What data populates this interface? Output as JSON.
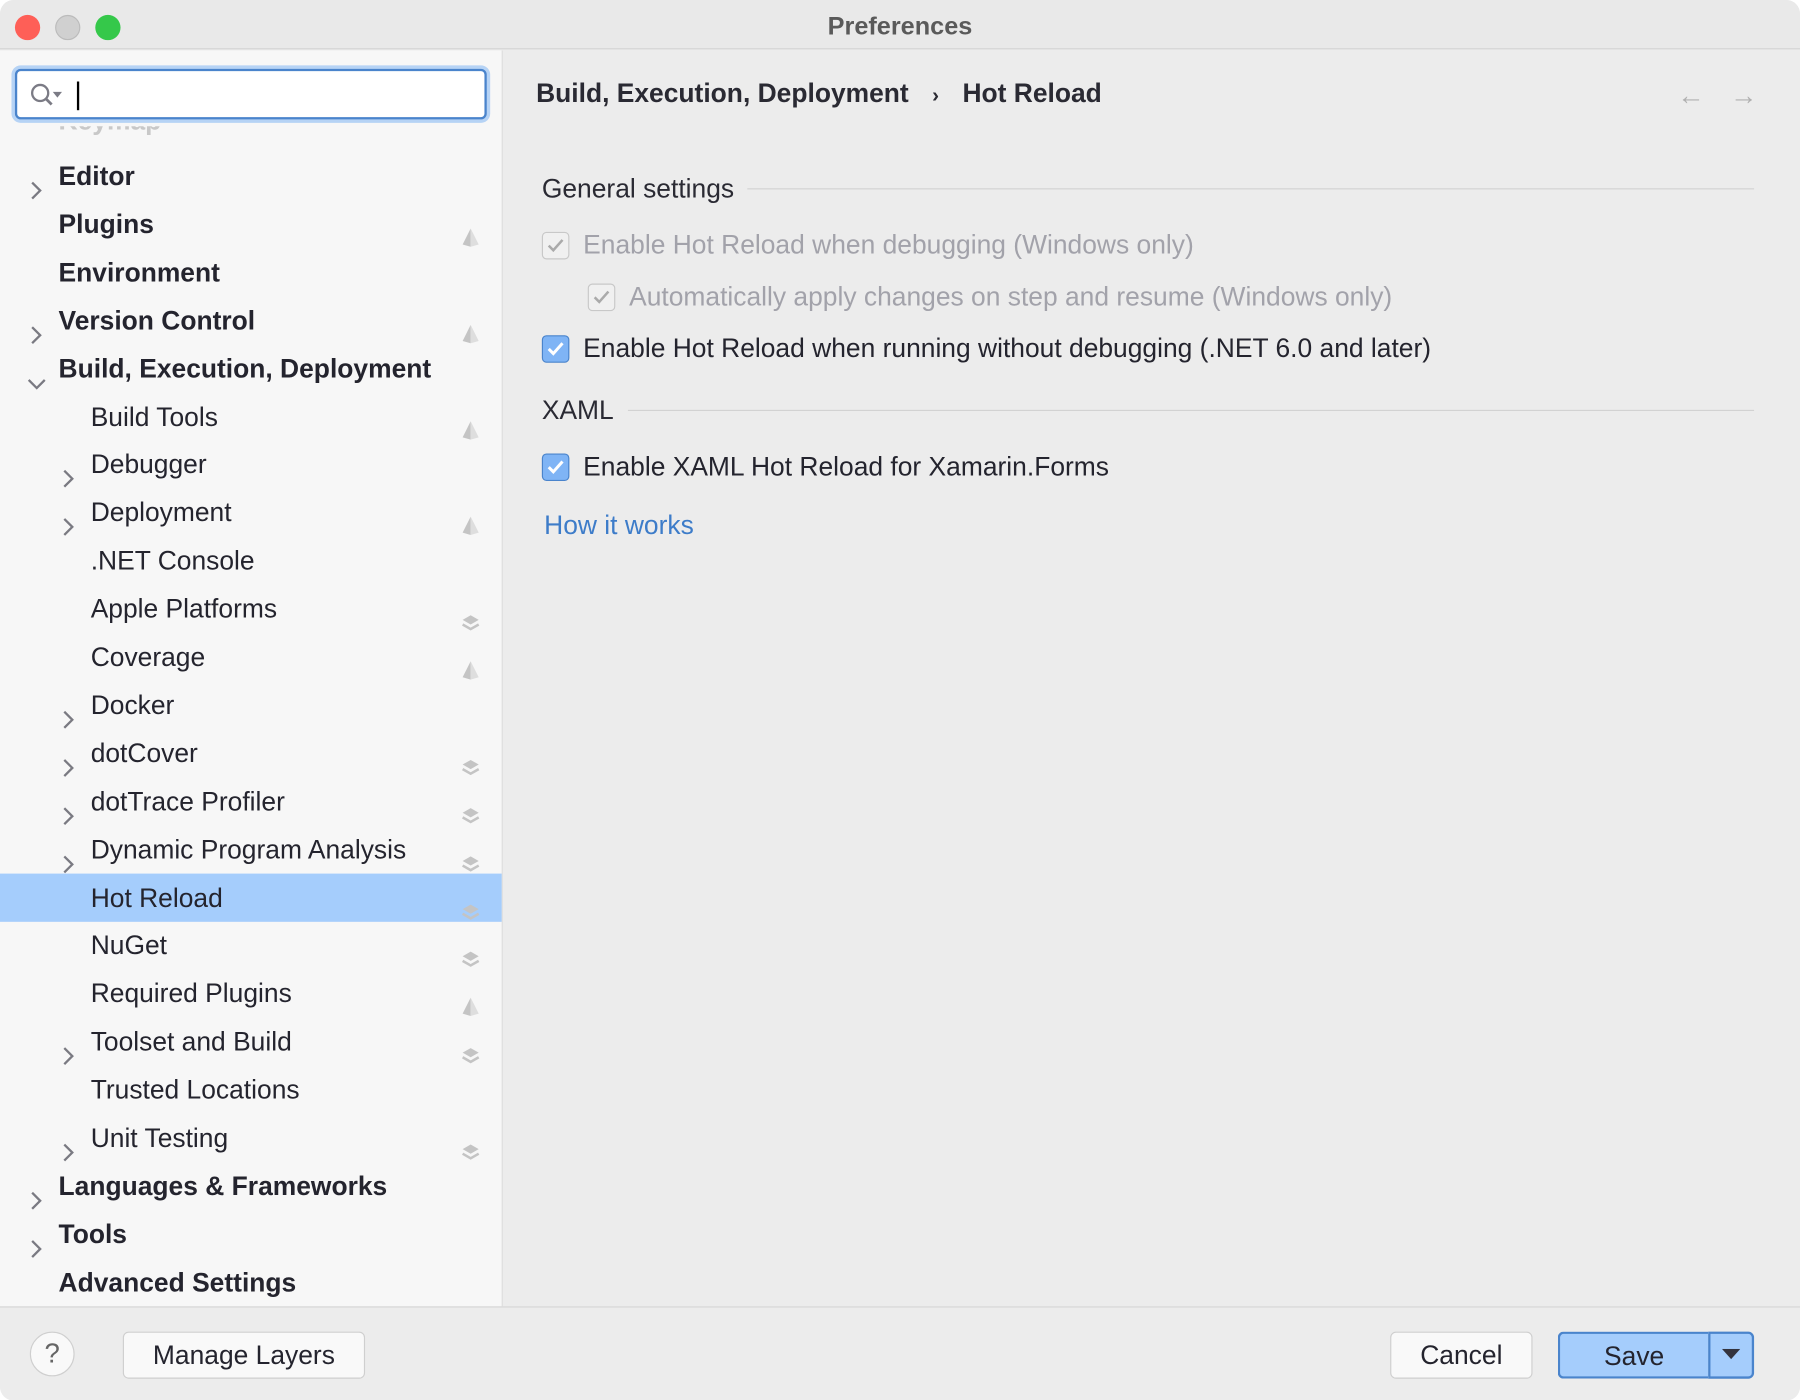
{
  "window": {
    "title": "Preferences"
  },
  "search": {
    "value": ""
  },
  "sidebar": {
    "cut_off_item": "Keymap",
    "items": [
      {
        "label": "Editor",
        "level": 0,
        "bold": true,
        "arrow": "collapsed",
        "icon": null
      },
      {
        "label": "Plugins",
        "level": 0,
        "bold": true,
        "arrow": null,
        "icon": "ide-scope-icon"
      },
      {
        "label": "Environment",
        "level": 0,
        "bold": true,
        "arrow": null,
        "icon": null
      },
      {
        "label": "Version Control",
        "level": 0,
        "bold": true,
        "arrow": "collapsed",
        "icon": "ide-scope-icon"
      },
      {
        "label": "Build, Execution, Deployment",
        "level": 0,
        "bold": true,
        "arrow": "expanded",
        "icon": null
      },
      {
        "label": "Build Tools",
        "level": 1,
        "arrow": null,
        "icon": "ide-scope-icon"
      },
      {
        "label": "Debugger",
        "level": 1,
        "arrow": "collapsed",
        "icon": null
      },
      {
        "label": "Deployment",
        "level": 1,
        "arrow": "collapsed",
        "icon": "ide-scope-icon"
      },
      {
        "label": ".NET Console",
        "level": 1,
        "arrow": null,
        "icon": null
      },
      {
        "label": "Apple Platforms",
        "level": 1,
        "arrow": null,
        "icon": "layers-icon"
      },
      {
        "label": "Coverage",
        "level": 1,
        "arrow": null,
        "icon": "ide-scope-icon"
      },
      {
        "label": "Docker",
        "level": 1,
        "arrow": "collapsed",
        "icon": null
      },
      {
        "label": "dotCover",
        "level": 1,
        "arrow": "collapsed",
        "icon": "layers-icon"
      },
      {
        "label": "dotTrace Profiler",
        "level": 1,
        "arrow": "collapsed",
        "icon": "layers-icon"
      },
      {
        "label": "Dynamic Program Analysis",
        "level": 1,
        "arrow": "collapsed",
        "icon": "layers-icon"
      },
      {
        "label": "Hot Reload",
        "level": 1,
        "arrow": null,
        "icon": "layers-icon",
        "selected": true
      },
      {
        "label": "NuGet",
        "level": 1,
        "arrow": null,
        "icon": "layers-icon"
      },
      {
        "label": "Required Plugins",
        "level": 1,
        "arrow": null,
        "icon": "ide-scope-icon"
      },
      {
        "label": "Toolset and Build",
        "level": 1,
        "arrow": "collapsed",
        "icon": "layers-icon"
      },
      {
        "label": "Trusted Locations",
        "level": 1,
        "arrow": null,
        "icon": null
      },
      {
        "label": "Unit Testing",
        "level": 1,
        "arrow": "collapsed",
        "icon": "layers-icon"
      },
      {
        "label": "Languages & Frameworks",
        "level": 0,
        "bold": true,
        "arrow": "collapsed",
        "icon": null
      },
      {
        "label": "Tools",
        "level": 0,
        "bold": true,
        "arrow": "collapsed",
        "icon": null
      },
      {
        "label": "Advanced Settings",
        "level": 0,
        "bold": true,
        "arrow": null,
        "icon": null
      }
    ]
  },
  "main": {
    "breadcrumb": [
      "Build, Execution, Deployment",
      "Hot Reload"
    ],
    "sections": {
      "general": "General settings",
      "xaml": "XAML"
    },
    "options": [
      {
        "label": "Enable Hot Reload when debugging (Windows only)",
        "checked": true,
        "disabled": true
      },
      {
        "label": "Automatically apply changes on step and resume (Windows only)",
        "checked": true,
        "disabled": true
      },
      {
        "label": "Enable Hot Reload when running without debugging (.NET 6.0 and later)",
        "checked": true,
        "disabled": false
      },
      {
        "label": "Enable XAML Hot Reload for Xamarin.Forms",
        "checked": true,
        "disabled": false
      }
    ],
    "link": "How it works"
  },
  "footer": {
    "help": "?",
    "manage_layers": "Manage Layers",
    "cancel": "Cancel",
    "save": "Save"
  },
  "colors": {
    "accent": "#4a84cc",
    "selection": "#a5cdfc",
    "link": "#3d7cc9"
  }
}
